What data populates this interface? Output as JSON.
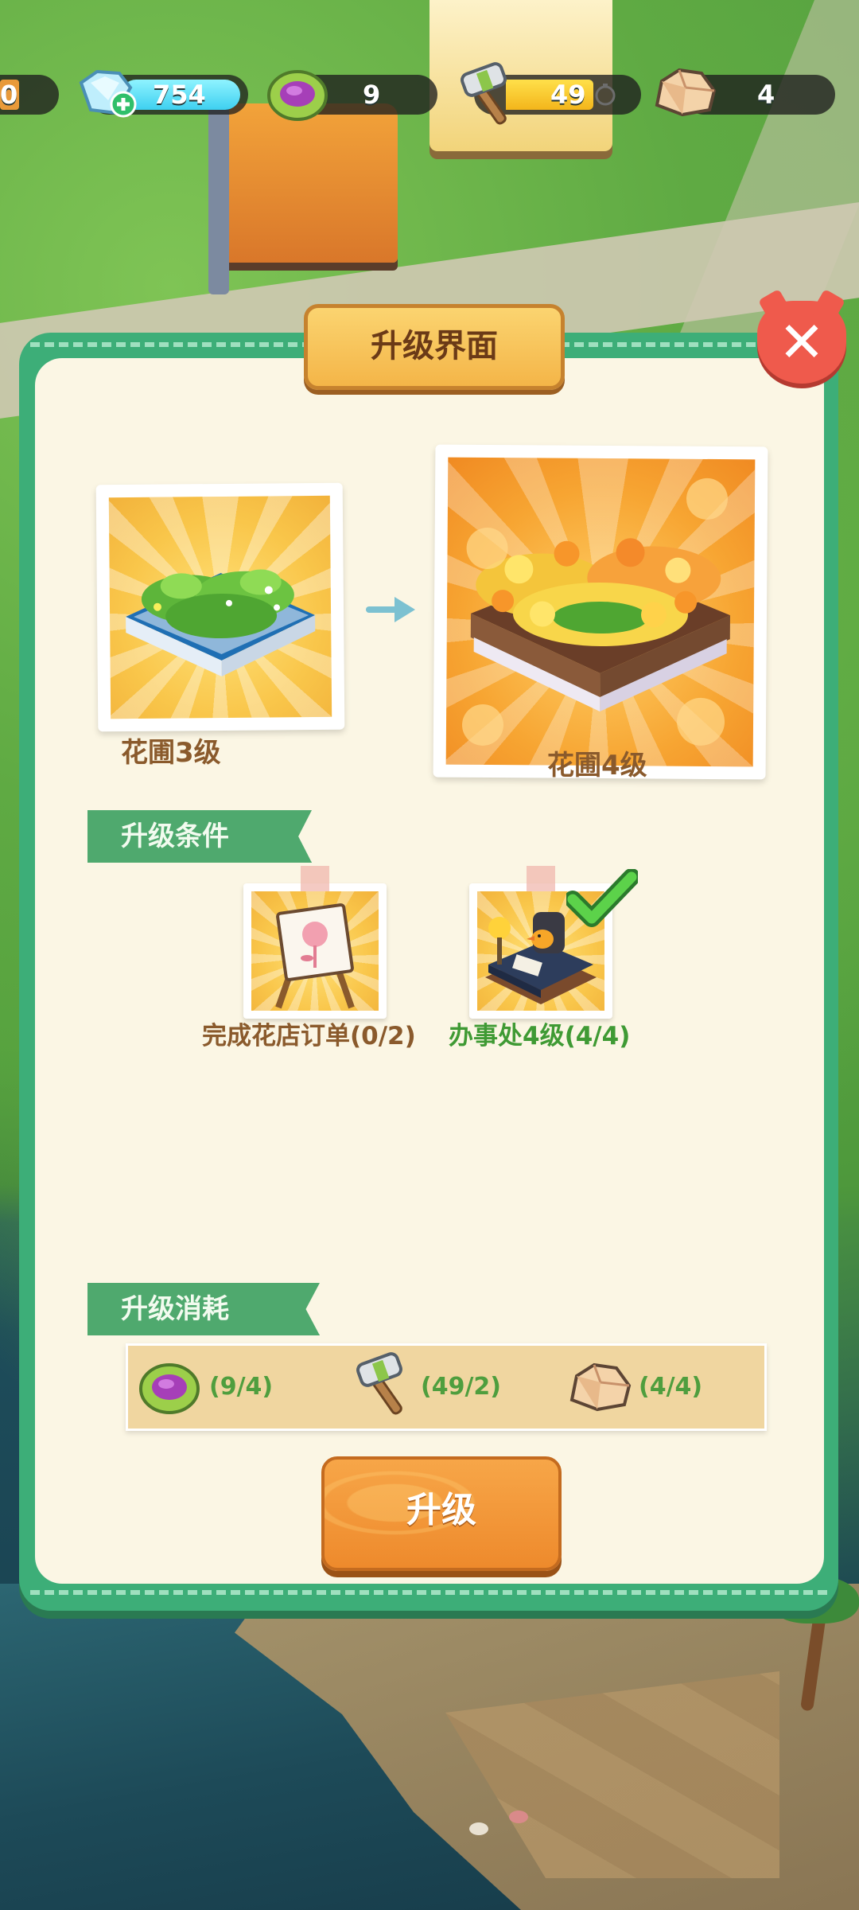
{
  "resources": {
    "left_partial": "0",
    "diamond": "754",
    "cabbage": "9",
    "hammer": "49",
    "stone": "4"
  },
  "dialog": {
    "title": "升级界面",
    "close_symbol": "✕",
    "current": {
      "caption": "花圃3级"
    },
    "next": {
      "caption": "花圃4级"
    },
    "conditions_title": "升级条件",
    "conditions": [
      {
        "label": "完成花店订单(0/2)",
        "color": "#8a5a2c",
        "done": false,
        "icon": "flower-easel-icon"
      },
      {
        "label": "办事处4级(4/4)",
        "color": "#3f9a34",
        "done": true,
        "icon": "office-desk-icon"
      }
    ],
    "cost_title": "升级消耗",
    "costs": [
      {
        "icon": "cabbage-icon",
        "label": "(9/4)"
      },
      {
        "icon": "hammer-icon",
        "label": "(49/2)"
      },
      {
        "icon": "stone-icon",
        "label": "(4/4)"
      }
    ],
    "upgrade_button": "升级"
  },
  "colors": {
    "panel_bg": "#fbf6e4",
    "frame_green": "#3dae78",
    "tag_green": "#4fa96e",
    "button_orange": "#ee8a2c",
    "close_red": "#ef5a4c",
    "complete_green": "#3f9a34"
  }
}
